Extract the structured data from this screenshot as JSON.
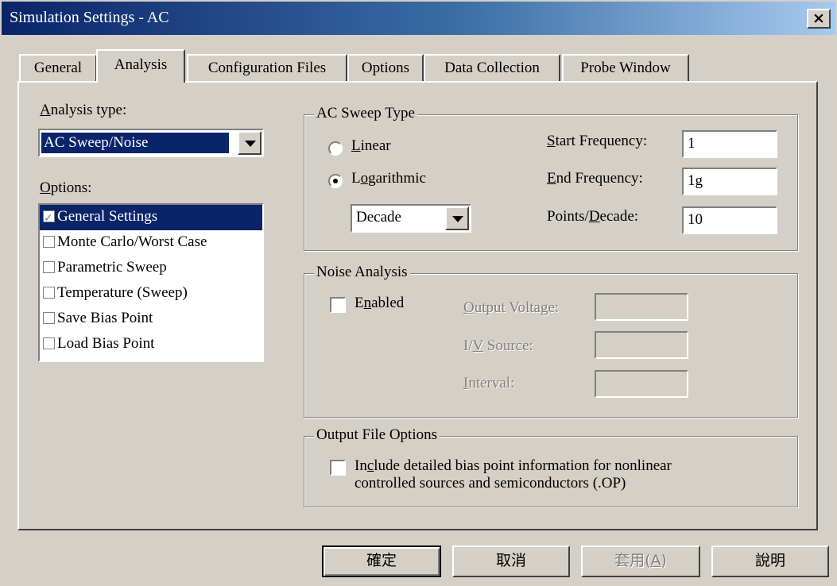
{
  "window": {
    "title": "Simulation Settings - AC",
    "close": "×"
  },
  "tabs": [
    {
      "label": "General"
    },
    {
      "label": "Analysis"
    },
    {
      "label": "Configuration Files"
    },
    {
      "label": "Options"
    },
    {
      "label": "Data Collection"
    },
    {
      "label": "Probe Window"
    }
  ],
  "left": {
    "analysis_type_label_key": "A",
    "analysis_type_label_rest": "nalysis type:",
    "analysis_type_value": "AC Sweep/Noise",
    "options_label_key": "O",
    "options_label_rest": "ptions:",
    "options": [
      {
        "label": "General Settings",
        "checked": true
      },
      {
        "label": "Monte Carlo/Worst Case",
        "checked": false
      },
      {
        "label": "Parametric Sweep",
        "checked": false
      },
      {
        "label": "Temperature (Sweep)",
        "checked": false
      },
      {
        "label": "Save Bias Point",
        "checked": false
      },
      {
        "label": "Load Bias Point",
        "checked": false
      }
    ]
  },
  "sweep": {
    "group_title": "AC Sweep Type",
    "linear_key": "L",
    "linear_rest": "inear",
    "log_pre": "L",
    "log_key": "o",
    "log_rest": "garithmic",
    "selected": "Logarithmic",
    "log_unit": "Decade",
    "start_key": "S",
    "start_rest": "tart Frequency:",
    "start_value": "1",
    "end_key": "E",
    "end_rest": "nd Frequency:",
    "end_value": "1g",
    "points_pre": "Points/",
    "points_key": "D",
    "points_rest": "ecade:",
    "points_value": "10"
  },
  "noise": {
    "group_title": "Noise Analysis",
    "enabled_pre": "E",
    "enabled_key": "n",
    "enabled_rest": "abled",
    "enabled": false,
    "output_key": "O",
    "output_rest": "utput Voltage:",
    "source_pre": "I/",
    "source_key": "V",
    "source_rest": " Source:",
    "interval_key": "I",
    "interval_rest": "nterval:"
  },
  "output_file": {
    "group_title": "Output File Options",
    "line1_pre": "In",
    "line1_key": "c",
    "line1_rest": "lude detailed bias point information for nonlinear",
    "line2": "controlled sources and semiconductors (.OP)",
    "checked": false
  },
  "buttons": {
    "ok": "確定",
    "cancel": "取消",
    "apply_pre": "套用(",
    "apply_key": "A",
    "apply_post": ")",
    "help": "說明"
  }
}
